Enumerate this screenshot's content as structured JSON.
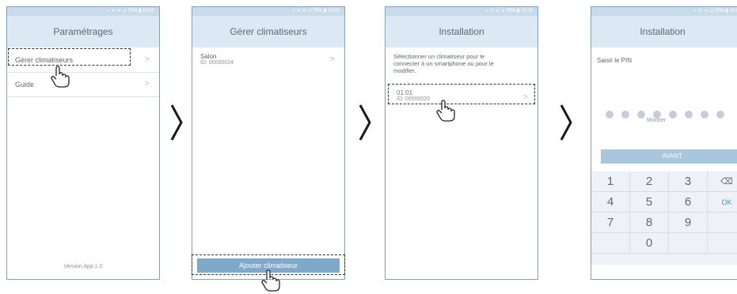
{
  "screen1": {
    "status": "◐ ✕ ᯤ ⊿ 75% ▮ 15:02",
    "title": "Paramétrages",
    "items": [
      {
        "label": "Gérer climatiseurs"
      },
      {
        "label": "Guide"
      }
    ],
    "version": "Version App 1.0"
  },
  "screen2": {
    "status": "◐ ✕ ᯤ ⊿ 75% ▮ 15:02",
    "title": "Gérer climatiseurs",
    "unit_name": "Salon",
    "unit_id": "ID: 00000024",
    "add_button": "Ajouter climatiseur"
  },
  "screen3": {
    "status": "◐ ✕ ᯤ ⊿ 75% ▮ 15:04",
    "title": "Installation",
    "instruction": "Sélectionner un climatiseur pour le connecter à un smartphone ou pour le modifier.",
    "unit_name": "01:01",
    "unit_id": "ID: 00000020"
  },
  "screen4": {
    "status": "◐ ✕ ᯤ ⊿ 75% ▮ 15:0",
    "title": "Installation",
    "prompt": "Saisir le PIN",
    "show_label": "Montrer",
    "next_button": "AVANT",
    "keys": [
      "1",
      "2",
      "3",
      "⌫",
      "4",
      "5",
      "6",
      "OK",
      "7",
      "8",
      "9",
      "",
      "",
      "0",
      "",
      ""
    ]
  },
  "colors": {
    "accent": "#7fa8c9",
    "title_bg": "#dce8f3",
    "status_bg": "#c8dbea",
    "frame": "#7aa3c8"
  }
}
